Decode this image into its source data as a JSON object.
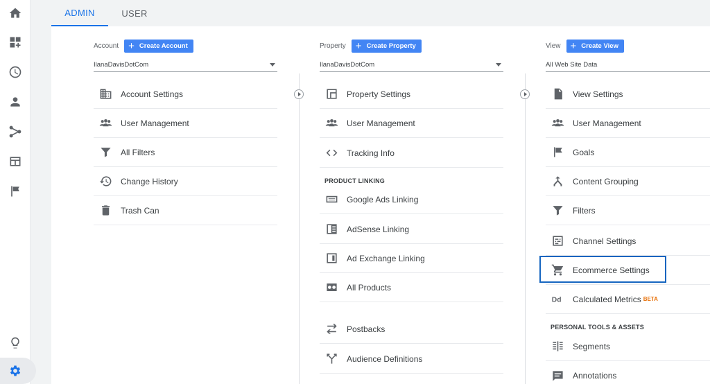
{
  "tabs": {
    "admin": "ADMIN",
    "user": "USER"
  },
  "colors": {
    "accent": "#1a73e8",
    "button": "#4285f4",
    "highlight": "#1565c0",
    "beta": "#e8710a"
  },
  "rail": {
    "icons": [
      "home-icon",
      "customization-icon",
      "realtime-icon",
      "audience-icon",
      "acquisition-icon",
      "behavior-icon",
      "conversions-icon",
      "discover-icon",
      "admin-gear-icon"
    ]
  },
  "account": {
    "label": "Account",
    "create_label": "Create Account",
    "selected": "IlanaDavisDotCom",
    "items": [
      {
        "label": "Account Settings",
        "icon": "building-icon"
      },
      {
        "label": "User Management",
        "icon": "people-icon"
      },
      {
        "label": "All Filters",
        "icon": "filter-icon"
      },
      {
        "label": "Change History",
        "icon": "history-icon"
      },
      {
        "label": "Trash Can",
        "icon": "trash-icon"
      }
    ]
  },
  "property": {
    "label": "Property",
    "create_label": "Create Property",
    "selected": "IlanaDavisDotCom",
    "items": [
      {
        "label": "Property Settings",
        "icon": "window-icon"
      },
      {
        "label": "User Management",
        "icon": "people-icon"
      },
      {
        "label": "Tracking Info",
        "icon": "code-icon"
      }
    ],
    "section_heading": "PRODUCT LINKING",
    "linking": [
      {
        "label": "Google Ads Linking",
        "icon": "ads-icon"
      },
      {
        "label": "AdSense Linking",
        "icon": "adsense-icon"
      },
      {
        "label": "Ad Exchange Linking",
        "icon": "adexchange-icon"
      },
      {
        "label": "All Products",
        "icon": "link-icon"
      },
      {
        "label": "Postbacks",
        "icon": "postbacks-icon"
      },
      {
        "label": "Audience Definitions",
        "icon": "fork-icon"
      }
    ]
  },
  "view": {
    "label": "View",
    "create_label": "Create View",
    "selected": "All Web Site Data",
    "items": [
      {
        "label": "View Settings",
        "icon": "document-icon"
      },
      {
        "label": "User Management",
        "icon": "people-icon"
      },
      {
        "label": "Goals",
        "icon": "flag-icon"
      },
      {
        "label": "Content Grouping",
        "icon": "grouping-icon"
      },
      {
        "label": "Filters",
        "icon": "filter-icon"
      },
      {
        "label": "Channel Settings",
        "icon": "channel-icon"
      },
      {
        "label": "Ecommerce Settings",
        "icon": "cart-icon"
      },
      {
        "label": "Calculated Metrics",
        "icon": "dd-icon",
        "badge": "BETA"
      }
    ],
    "section_heading": "PERSONAL TOOLS & ASSETS",
    "tools": [
      {
        "label": "Segments",
        "icon": "segments-icon"
      },
      {
        "label": "Annotations",
        "icon": "annotation-icon"
      }
    ]
  }
}
